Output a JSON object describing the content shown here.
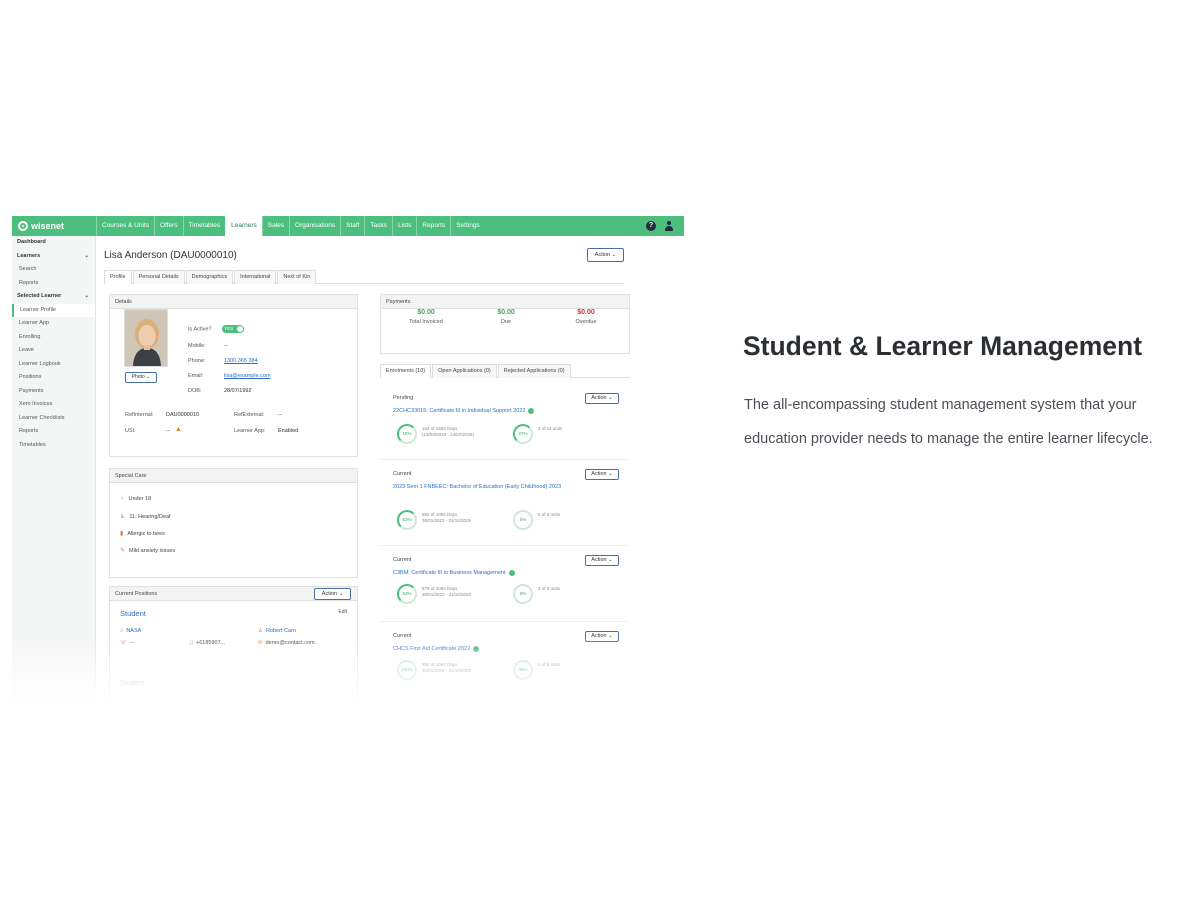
{
  "app": {
    "brand": "wisenet",
    "nav": [
      "Courses & Units",
      "Offers",
      "Timetables",
      "Learners",
      "Sales",
      "Organisations",
      "Staff",
      "Tasks",
      "Lists",
      "Reports",
      "Settings"
    ],
    "active_nav": "Learners"
  },
  "sidebar": {
    "items": [
      {
        "label": "Dashboard",
        "type": "head"
      },
      {
        "label": "Learners",
        "type": "head-expand"
      },
      {
        "label": "Search",
        "type": "item"
      },
      {
        "label": "Reports",
        "type": "item"
      },
      {
        "label": "Selected Learner",
        "type": "head-expand"
      },
      {
        "label": "Learner Profile",
        "type": "active"
      },
      {
        "label": "Learner App",
        "type": "item"
      },
      {
        "label": "Enrolling",
        "type": "item"
      },
      {
        "label": "Leave",
        "type": "item"
      },
      {
        "label": "Learner Logbook",
        "type": "item"
      },
      {
        "label": "Positions",
        "type": "item"
      },
      {
        "label": "Payments",
        "type": "item"
      },
      {
        "label": "Xero Invoices",
        "type": "item"
      },
      {
        "label": "Learner Checklists",
        "type": "item"
      },
      {
        "label": "Reports",
        "type": "item"
      },
      {
        "label": "Timetables",
        "type": "item"
      }
    ]
  },
  "learner": {
    "title": "Lisa Anderson (DAU0000010)",
    "action_label": "Action",
    "tabs": [
      "Profile",
      "Personal Details",
      "Demographics",
      "International",
      "Next of Kin"
    ],
    "active_tab": "Profile"
  },
  "details": {
    "header": "Details",
    "photo_button": "Photo",
    "is_active_label": "Is Active?",
    "is_active_value": "YES",
    "mobile_label": "Mobile:",
    "mobile_value": "--",
    "phone_label": "Phone:",
    "phone_value": "1300 365 384",
    "email_label": "Email:",
    "email_value": "lisa@example.com",
    "dob_label": "DOB:",
    "dob_value": "28/07/1992",
    "refinternal_label": "RefInternal:",
    "refinternal_value": "DAU0000010",
    "refexternal_label": "RefExternal:",
    "refexternal_value": "--",
    "usi_label": "USI:",
    "usi_value": "--",
    "learner_app_label": "Learner App:",
    "learner_app_value": "Enabled"
  },
  "special_care": {
    "header": "Special Care",
    "items": [
      "Under 18",
      "11: Hearing/Deaf",
      "Allergic to bees",
      "Mild anxiety issues"
    ]
  },
  "positions": {
    "header": "Current Positions",
    "action_label": "Action",
    "title": "Student",
    "edit_label": "Edit",
    "org": "NASA",
    "contact": "Robert Carn",
    "phone": "--",
    "mobile": "+6185907...",
    "email": "demo@contact.com.",
    "title2": "Student"
  },
  "payments": {
    "header": "Payments",
    "total_invoiced_value": "$0.00",
    "total_invoiced_label": "Total Invoiced",
    "due_value": "$0.00",
    "due_label": "Due",
    "overdue_value": "$0.00",
    "overdue_label": "Overdue"
  },
  "enrolment_tabs": [
    "Enrolments (10)",
    "Open Applications (0)",
    "Rejected Applications (0)"
  ],
  "enrolments": [
    {
      "status": "Pending",
      "title": "22CHC33015: Certificate III in Individual Support 2022",
      "action": "Action",
      "ring1": "15%",
      "days": "154 of 1583 Days",
      "dates": "(15/03/2023 - 14/07/2026)",
      "ring2": "27%",
      "units": "3 of 11 units"
    },
    {
      "status": "Current",
      "title": "2023 Sem 1 FNBEEC: Bachelor of Education (Early Childhood) 2023",
      "action": "Action",
      "ring1": "53%",
      "days": "582 of 1094 Days",
      "dates": "30/01/2023 - 31/12/2025",
      "ring2": "0%",
      "units": "0 of 5 units"
    },
    {
      "status": "Current",
      "title": "C3BM: Certificate III in Business Management",
      "action": "Action",
      "ring1": "53%",
      "days": "579 of 1094 Days",
      "dates": "30/01/2021 - 31/10/2023",
      "ring2": "0%",
      "units": "3 of 5 units"
    },
    {
      "status": "Current",
      "title": "CHCS First Aid Certificate 2022",
      "action": "Action",
      "ring1": "100%",
      "days": "556 of 1094 Days",
      "dates": "30/01/2026 - 31/10/2023",
      "ring2": "36%",
      "units": "4 of 8 units"
    }
  ],
  "marketing": {
    "headline": "Student & Learner Management",
    "description": "The all-encompassing student management system that your education provider needs to manage the entire learner lifecycle."
  },
  "colors": {
    "brand_green": "#4cbf7f",
    "link_blue": "#2d6fc4",
    "overdue_red": "#c0392b"
  }
}
